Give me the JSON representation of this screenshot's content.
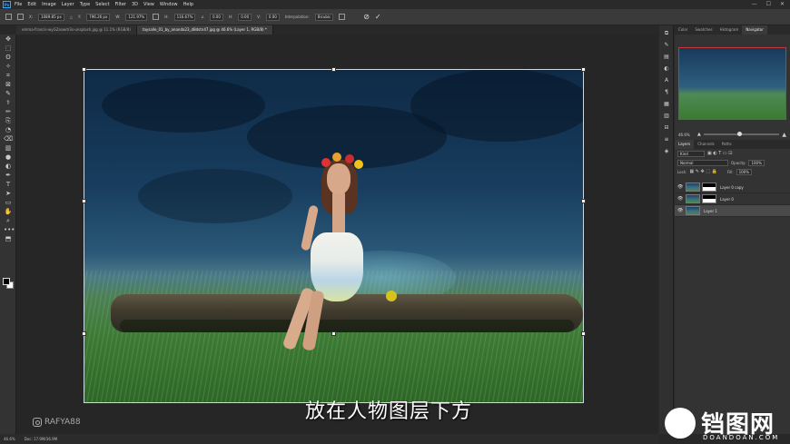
{
  "app": {
    "logo": "Ps"
  },
  "menu": [
    "File",
    "Edit",
    "Image",
    "Layer",
    "Type",
    "Select",
    "Filter",
    "3D",
    "View",
    "Window",
    "Help"
  ],
  "window_controls": [
    "—",
    "☐",
    "✕"
  ],
  "options": {
    "x_value": "1089.85 px",
    "y_value": "796.26 px",
    "w_value": "121.97%",
    "h_value": "116.67%",
    "angle_value": "0.00",
    "h_skew": "0.00",
    "v_skew": "0.00",
    "interpolation_label": "Interpolation:",
    "interpolation_value": "Bicubic"
  },
  "tabs": [
    {
      "label": "emma-francis-wyG2aswdr3s-unsplash.jpg @ 11.1% (RGB/8)",
      "active": false
    },
    {
      "label": "taysalle_01_by_ananda23_d8dstn47.jpg @ 46.6% (Layer 1, RGB/8) *",
      "active": true
    }
  ],
  "tools": [
    "✥",
    "⬚",
    "ʘ",
    "✧",
    "⌗",
    "⊠",
    "✎",
    "⚕",
    "✏",
    "⎘",
    "◔",
    "⌫",
    "▥",
    "●",
    "◐",
    "✒",
    "T",
    "➤",
    "▭",
    "✋",
    "⌕",
    "•••",
    "⬒"
  ],
  "right_dock_icons": [
    "⧉",
    "✎",
    "▤",
    "◐",
    "A",
    "¶",
    "▦",
    "▥",
    "⊟",
    "≡",
    "◈"
  ],
  "panel_tabs": [
    {
      "label": "Color",
      "active": false
    },
    {
      "label": "Swatches",
      "active": false
    },
    {
      "label": "Histogram",
      "active": false
    },
    {
      "label": "Navigator",
      "active": true
    }
  ],
  "navigator": {
    "zoom": "46.6%"
  },
  "layers_tabs": [
    {
      "label": "Layers",
      "active": true
    },
    {
      "label": "Channels",
      "active": false
    },
    {
      "label": "Paths",
      "active": false
    }
  ],
  "layers_controls": {
    "kind": "Kind",
    "blend": "Normal",
    "opacity_label": "Opacity:",
    "opacity": "100%",
    "lock_label": "Lock:",
    "fill_label": "Fill:",
    "fill": "100%"
  },
  "layers": [
    {
      "name": "Layer 0 copy",
      "mask": true,
      "selected": false
    },
    {
      "name": "Layer 0",
      "mask": true,
      "selected": false
    },
    {
      "name": "Layer 1",
      "mask": false,
      "selected": true
    }
  ],
  "status": {
    "zoom": "46.6%",
    "doc": "Doc: 17.9M/36.9M"
  },
  "subtitle": "放在人物图层下方",
  "watermark_left": "RAFYA88",
  "watermark_right_big": "铛图网",
  "watermark_right_small": "DOANDOAN.COM"
}
